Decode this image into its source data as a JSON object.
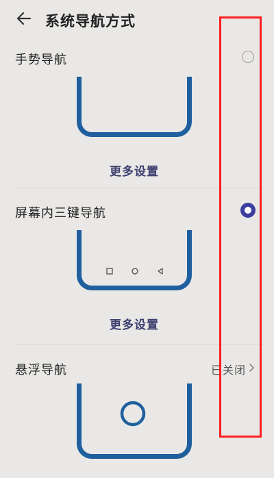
{
  "header": {
    "title": "系统导航方式",
    "back_icon": "arrow-left-icon"
  },
  "options": {
    "gesture": {
      "label": "手势导航",
      "more_label": "更多设置",
      "selected": false
    },
    "three_key": {
      "label": "屏幕内三键导航",
      "more_label": "更多设置",
      "selected": true,
      "nav_icons": [
        "square-icon",
        "circle-icon",
        "triangle-back-icon"
      ]
    },
    "floating": {
      "label": "悬浮导航",
      "status": "已关闭"
    }
  },
  "colors": {
    "background": "#e9e8e6",
    "phone_outline": "#1f5f9e",
    "radio_selected": "#3b3fa0",
    "link_text": "#3b3f6e",
    "annotation_box": "#ff1e1e"
  }
}
